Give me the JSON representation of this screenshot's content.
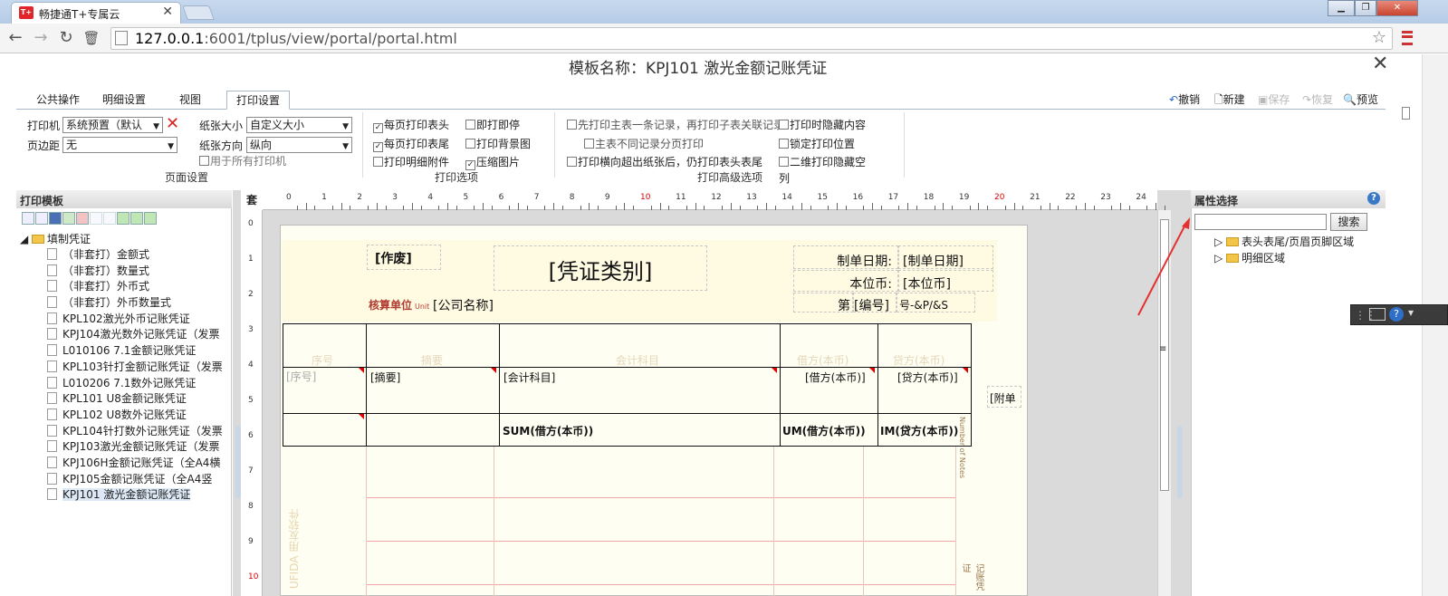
{
  "browser": {
    "tab_title": "畅捷通T+专属云",
    "tab_favicon": "T+",
    "url_host": "127.0.0.1",
    "url_rest": ":6001/tplus/view/portal/portal.html"
  },
  "dialog": {
    "title": "模板名称：KPJ101 激光金额记账凭证"
  },
  "tabs": [
    {
      "label": "公共操作"
    },
    {
      "label": "明细设置"
    },
    {
      "label": "视图"
    },
    {
      "label": "打印设置"
    }
  ],
  "toolbar": {
    "undo": "撤销",
    "new": "新建",
    "save": "保存",
    "restore": "恢复",
    "preview": "预览"
  },
  "page_setup": {
    "printer_label": "打印机",
    "printer_value": "系统预置（默认",
    "margin_label": "页边距",
    "margin_value": "无",
    "paper_size_label": "纸张大小",
    "paper_size_value": "自定义大小",
    "orientation_label": "纸张方向",
    "orientation_value": "纵向",
    "all_printers": "用于所有打印机",
    "group_label": "页面设置"
  },
  "print_options": {
    "header_each": "每页打印表头",
    "footer_each": "每页打印表尾",
    "detail_attach": "打印明细附件",
    "print_stop": "即打即停",
    "background": "打印背景图",
    "compress_image": "压缩图片",
    "group_label": "打印选项"
  },
  "advanced": {
    "main_first": "先打印主表一条记录，再打印子表关联记录",
    "split_pages": "主表不同记录分页打印",
    "horizontal": "打印横向超出纸张后，仍打印表头表尾",
    "hide_content": "打印时隐藏内容",
    "lock_pos": "锁定打印位置",
    "qr_hide_1": "二维打印隐藏空",
    "qr_hide_2": "列",
    "group_label": "打印高级选项"
  },
  "left_panel": {
    "title": "打印模板",
    "root": "填制凭证",
    "items": [
      "（非套打）金额式",
      "（非套打）数量式",
      "（非套打）外币式",
      "（非套打）外币数量式",
      "KPL102激光外币记账凭证",
      "KPJ104激光数外记账凭证（发票",
      "L010106 7.1金额记账凭证",
      "KPL103针打金额记账凭证（发票",
      "L010206 7.1数外记账凭证",
      "KPL101 U8金额记账凭证",
      "KPL102 U8数外记账凭证",
      "KPL104针打数外记账凭证（发票",
      "KPJ103激光金额记账凭证（发票",
      "KPJ106H金额记账凭证（全A4横",
      "KPJ105金额记账凭证（全A4竖",
      "KPJ101 激光金额记账凭证"
    ]
  },
  "ruler": {
    "corner": "套",
    "h": [
      "0",
      "1",
      "2",
      "3",
      "4",
      "5",
      "6",
      "7",
      "8",
      "9",
      "10",
      "11",
      "12",
      "13",
      "14",
      "15",
      "16",
      "17",
      "18",
      "19",
      "20",
      "21",
      "22",
      "23",
      "24"
    ],
    "v": [
      "0",
      "1",
      "2",
      "3",
      "4",
      "5",
      "6",
      "7",
      "8",
      "9",
      "10"
    ]
  },
  "paper": {
    "void": "[作废]",
    "category": "[凭证类别]",
    "date_label": "制单日期:",
    "date_value": "[制单日期]",
    "currency_label": "本位币:",
    "currency_value": "[本位币]",
    "unit_label": "核算单位",
    "unit_label_en": "Unit",
    "company": "[公司名称]",
    "no_prefix": "第",
    "no_value": "[编号]",
    "no_suffix": "号-&P/&S",
    "col_faint": [
      "序号",
      "摘要",
      "会计科目",
      "借方(本币)",
      "贷方(本币)"
    ],
    "row": [
      "[序号]",
      "[摘要]",
      "[会计科目]",
      "[借方(本币)]",
      "[贷方(本币)]"
    ],
    "attach": "[附单",
    "sum": "SUM(借方(本币))",
    "sum_debit": "UM(借方(本币))",
    "sum_credit": "IM(贷方(本币))",
    "side_note": "Number of Notes",
    "side_brand": "UFIDA 用友软件",
    "side_voucher": "记账凭证"
  },
  "right_panel": {
    "title": "属性选择",
    "search_btn": "搜索",
    "nodes": [
      "表头表尾/页眉页脚区域",
      "明细区域"
    ]
  }
}
